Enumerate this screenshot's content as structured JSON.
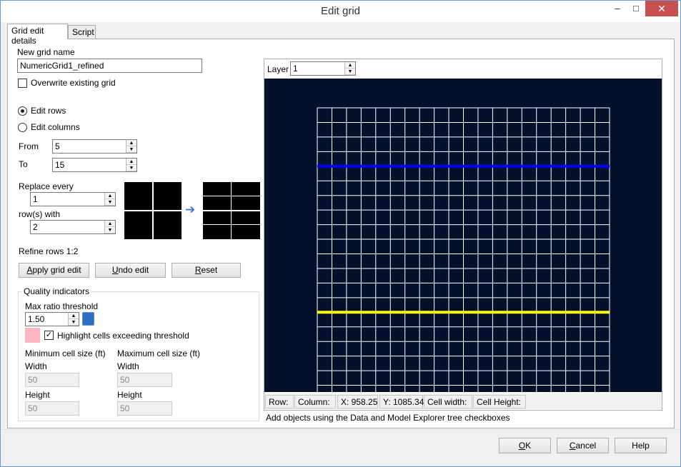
{
  "window": {
    "title": "Edit grid",
    "minimize_glyph": "‒",
    "maximize_glyph": "□",
    "close_glyph": "✕"
  },
  "tabs": [
    {
      "label": "Grid edit details",
      "selected": true
    },
    {
      "label": "Script",
      "selected": false
    }
  ],
  "form": {
    "new_grid_name_label": "New grid name",
    "new_grid_name_value": "NumericGrid1_refined",
    "overwrite_label": "Overwrite existing grid",
    "overwrite_checked": false,
    "edit_rows_label": "Edit rows",
    "edit_columns_label": "Edit columns",
    "edit_mode": "rows",
    "from_label": "From",
    "from_value": "5",
    "to_label": "To",
    "to_value": "15",
    "replace_every_label": "Replace every",
    "replace_every_value": "1",
    "rows_with_label": "row(s) with",
    "rows_with_value": "2",
    "refine_summary": "Refine rows 1:2",
    "arrow_glyph": "➔"
  },
  "actions": {
    "apply_pre": "",
    "apply_u": "A",
    "apply_post": "pply grid edit",
    "undo_pre": "",
    "undo_u": "U",
    "undo_post": "ndo edit",
    "reset_pre": "",
    "reset_u": "R",
    "reset_post": "eset"
  },
  "quality": {
    "group_title": "Quality indicators",
    "max_ratio_label": "Max ratio threshold",
    "max_ratio_value": "1.50",
    "highlight_label": "Highlight cells exceeding threshold",
    "highlight_checked": true,
    "highlight_swatch_color": "#ffb6c1",
    "min_cell_label": "Minimum cell size (ft)",
    "max_cell_label": "Maximum cell size (ft)",
    "width_label": "Width",
    "height_label": "Height",
    "min_width": "50",
    "min_height": "50",
    "max_width": "50",
    "max_height": "50"
  },
  "viewer": {
    "layer_label": "Layer",
    "layer_value": "1",
    "background_color": "#05102c",
    "grid_line_color": "#ffffff",
    "grid_columns": 20,
    "grid_rows_visible": 19,
    "highlight_from_color": "#0000ff",
    "highlight_to_color": "#ffff00",
    "status": {
      "row": "Row:",
      "column": "Column:",
      "x": "X: 958.25",
      "y": "Y: 1085.34",
      "cell_width": "Cell width:",
      "cell_height": "Cell Height:"
    },
    "hint": "Add objects using the Data and Model Explorer tree checkboxes"
  },
  "footer": {
    "ok_u": "O",
    "ok_post": "K",
    "cancel_u": "C",
    "cancel_post": "ancel",
    "help_label": "Help"
  }
}
